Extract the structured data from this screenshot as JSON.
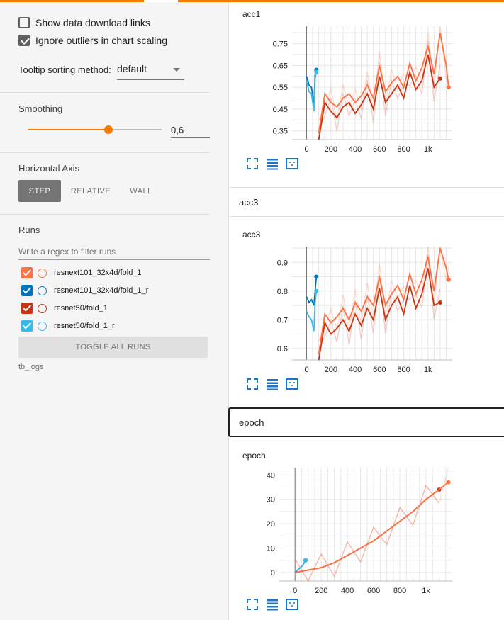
{
  "colors": {
    "accent": "#f57c00",
    "run_fold1_x101": "#ff7043",
    "run_fold1r_x101": "#0077bb",
    "run_fold1_r50": "#cc3311",
    "run_fold1r_r50": "#33bbee"
  },
  "sidebar": {
    "show_download_links": {
      "label": "Show data download links",
      "checked": false
    },
    "ignore_outliers": {
      "label": "Ignore outliers in chart scaling",
      "checked": true
    },
    "tooltip_sort": {
      "label": "Tooltip sorting method:",
      "value": "default"
    },
    "smoothing": {
      "label": "Smoothing",
      "value": "0,6",
      "level": 0.6
    },
    "horizontal_axis": {
      "label": "Horizontal Axis",
      "options": [
        "STEP",
        "RELATIVE",
        "WALL"
      ],
      "selected": "STEP"
    },
    "runs": {
      "label": "Runs",
      "filter_placeholder": "Write a regex to filter runs",
      "items": [
        {
          "name": "resnext101_32x4d/fold_1",
          "color": "#ff7043",
          "checked": true
        },
        {
          "name": "resnext101_32x4d/fold_1_r",
          "color": "#0077bb",
          "checked": true
        },
        {
          "name": "resnet50/fold_1",
          "color": "#cc3311",
          "checked": true
        },
        {
          "name": "resnet50/fold_1_r",
          "color": "#33bbee",
          "checked": true
        }
      ],
      "toggle_label": "TOGGLE ALL RUNS",
      "logdir": "tb_logs"
    }
  },
  "main": {
    "groups": [
      {
        "name": "acc3"
      },
      {
        "name": "epoch"
      }
    ],
    "chart_icons": [
      "fullscreen-icon",
      "data-table-icon",
      "fit-domain-icon"
    ]
  },
  "chart_data": [
    {
      "type": "line",
      "title": "acc1",
      "xlabel": "",
      "ylabel": "",
      "x_ticks": [
        "0",
        "200",
        "400",
        "600",
        "800",
        "1k"
      ],
      "y_ticks": [
        "0.35",
        "0.45",
        "0.55",
        "0.65",
        "0.75"
      ],
      "xlim": [
        -120,
        1200
      ],
      "ylim": [
        0.31,
        0.83
      ],
      "grid": true,
      "series": [
        {
          "color": "#0077bb",
          "x": [
            0,
            20,
            40,
            60,
            70,
            80
          ],
          "y": [
            0.6,
            0.56,
            0.55,
            0.47,
            0.61,
            0.63
          ]
        },
        {
          "color": "#33bbee",
          "x": [
            0,
            20,
            40,
            60,
            70,
            80
          ],
          "y": [
            0.58,
            0.53,
            0.52,
            0.44,
            0.59,
            0.62
          ]
        },
        {
          "color": "#cc3311",
          "x": [
            100,
            150,
            200,
            250,
            300,
            350,
            400,
            450,
            500,
            550,
            600,
            650,
            700,
            750,
            800,
            850,
            900,
            950,
            1000,
            1050,
            1100
          ],
          "y": [
            0.3,
            0.48,
            0.44,
            0.41,
            0.46,
            0.48,
            0.43,
            0.47,
            0.52,
            0.45,
            0.6,
            0.48,
            0.52,
            0.56,
            0.5,
            0.62,
            0.54,
            0.58,
            0.7,
            0.55,
            0.59
          ]
        },
        {
          "color": "#ff7043",
          "x": [
            100,
            150,
            200,
            250,
            300,
            350,
            400,
            450,
            500,
            550,
            600,
            650,
            700,
            750,
            800,
            850,
            900,
            950,
            1000,
            1050,
            1100,
            1150,
            1170
          ],
          "y": [
            0.34,
            0.52,
            0.48,
            0.46,
            0.5,
            0.52,
            0.48,
            0.51,
            0.56,
            0.5,
            0.65,
            0.53,
            0.57,
            0.6,
            0.55,
            0.66,
            0.58,
            0.64,
            0.74,
            0.61,
            0.8,
            0.65,
            0.55
          ]
        }
      ]
    },
    {
      "type": "line",
      "title": "acc3",
      "xlabel": "",
      "ylabel": "",
      "x_ticks": [
        "0",
        "200",
        "400",
        "600",
        "800",
        "1k"
      ],
      "y_ticks": [
        "0.6",
        "0.7",
        "0.8",
        "0.9"
      ],
      "xlim": [
        -120,
        1200
      ],
      "ylim": [
        0.56,
        0.955
      ],
      "grid": true,
      "series": [
        {
          "color": "#0077bb",
          "x": [
            0,
            20,
            40,
            60,
            70,
            80
          ],
          "y": [
            0.78,
            0.76,
            0.77,
            0.75,
            0.8,
            0.85
          ]
        },
        {
          "color": "#33bbee",
          "x": [
            0,
            20,
            40,
            60,
            70,
            80
          ],
          "y": [
            0.73,
            0.71,
            0.7,
            0.66,
            0.76,
            0.8
          ]
        },
        {
          "color": "#cc3311",
          "x": [
            100,
            150,
            200,
            250,
            300,
            350,
            400,
            450,
            500,
            550,
            600,
            650,
            700,
            750,
            800,
            850,
            900,
            950,
            1000,
            1050,
            1100
          ],
          "y": [
            0.55,
            0.69,
            0.65,
            0.67,
            0.7,
            0.66,
            0.72,
            0.68,
            0.74,
            0.7,
            0.81,
            0.7,
            0.75,
            0.78,
            0.72,
            0.82,
            0.74,
            0.79,
            0.88,
            0.75,
            0.76
          ]
        },
        {
          "color": "#ff7043",
          "x": [
            100,
            150,
            200,
            250,
            300,
            350,
            400,
            450,
            500,
            550,
            600,
            650,
            700,
            750,
            800,
            850,
            900,
            950,
            1000,
            1050,
            1100,
            1150,
            1170
          ],
          "y": [
            0.58,
            0.72,
            0.69,
            0.71,
            0.74,
            0.7,
            0.76,
            0.73,
            0.78,
            0.75,
            0.85,
            0.75,
            0.79,
            0.82,
            0.77,
            0.86,
            0.79,
            0.84,
            0.92,
            0.8,
            0.95,
            0.88,
            0.84
          ]
        }
      ]
    },
    {
      "type": "line",
      "title": "epoch",
      "xlabel": "",
      "ylabel": "",
      "x_ticks": [
        "0",
        "200",
        "400",
        "600",
        "800",
        "1k"
      ],
      "y_ticks": [
        "0",
        "10",
        "20",
        "30",
        "40"
      ],
      "xlim": [
        -120,
        1200
      ],
      "ylim": [
        -3.5,
        43
      ],
      "grid": true,
      "series": [
        {
          "color": "#0077bb",
          "x": [
            0,
            20,
            40,
            60,
            70,
            80
          ],
          "y": [
            0,
            1,
            2,
            3,
            4,
            5
          ]
        },
        {
          "color": "#33bbee",
          "x": [
            0,
            20,
            40,
            60,
            70,
            80
          ],
          "y": [
            0,
            1,
            2,
            3,
            4,
            5
          ]
        },
        {
          "color": "#cc3311",
          "x": [
            0,
            100,
            200,
            300,
            400,
            500,
            600,
            700,
            800,
            900,
            1000,
            1100
          ],
          "y": [
            0,
            1,
            2,
            4,
            7,
            10,
            13,
            17,
            21,
            25,
            30,
            34
          ]
        },
        {
          "color": "#ff7043",
          "x": [
            0,
            100,
            200,
            300,
            400,
            500,
            600,
            700,
            800,
            900,
            1000,
            1100,
            1170
          ],
          "y": [
            0,
            1,
            2,
            4,
            7,
            10,
            13,
            17,
            21,
            25,
            30,
            34,
            37
          ]
        }
      ]
    }
  ]
}
